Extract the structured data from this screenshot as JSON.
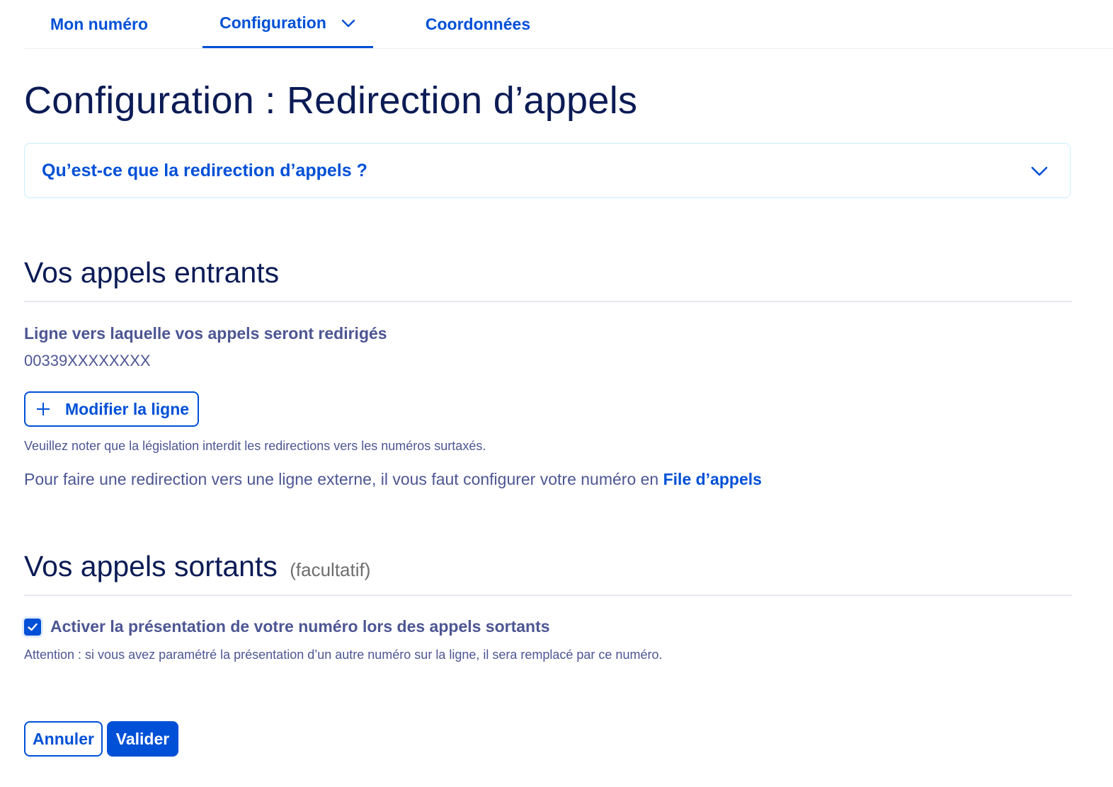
{
  "tabs": [
    {
      "label": "Mon numéro",
      "active": false
    },
    {
      "label": "Configuration",
      "active": true,
      "icon": "chevron-down-icon"
    },
    {
      "label": "Coordonnées",
      "active": false
    }
  ],
  "page": {
    "title": "Configuration : Redirection d’appels"
  },
  "accordion": {
    "label": "Qu’est-ce que la redirection d’appels ?",
    "icon": "chevron-down-icon",
    "expanded": false
  },
  "incoming": {
    "title": "Vos appels entrants",
    "field_label": "Ligne vers laquelle vos appels seront redirigés",
    "field_value": "00339XXXXXXXX",
    "modify_button": "Modifier la ligne",
    "modify_icon": "plus-icon",
    "legal_note": "Veuillez noter que la législation interdit les redirections vers les numéros surtaxés.",
    "external_text": "Pour faire une redirection vers une ligne externe, il vous faut configurer votre numéro en ",
    "external_link": "File d’appels"
  },
  "outgoing": {
    "title": "Vos appels sortants",
    "optional": "(facultatif)",
    "checkbox_label": "Activer la présentation de votre numéro lors des appels sortants",
    "checkbox_checked": true,
    "warning": "Attention : si vous avez paramétré la présentation d’un autre numéro sur la ligne, il sera remplacé par ce numéro."
  },
  "actions": {
    "cancel": "Annuler",
    "submit": "Valider"
  },
  "colors": {
    "primary": "#0050d7",
    "heading": "#0b1b55",
    "text": "#4d5693",
    "muted": "#6e6e6e",
    "accordion_border": "#c9eefb"
  }
}
